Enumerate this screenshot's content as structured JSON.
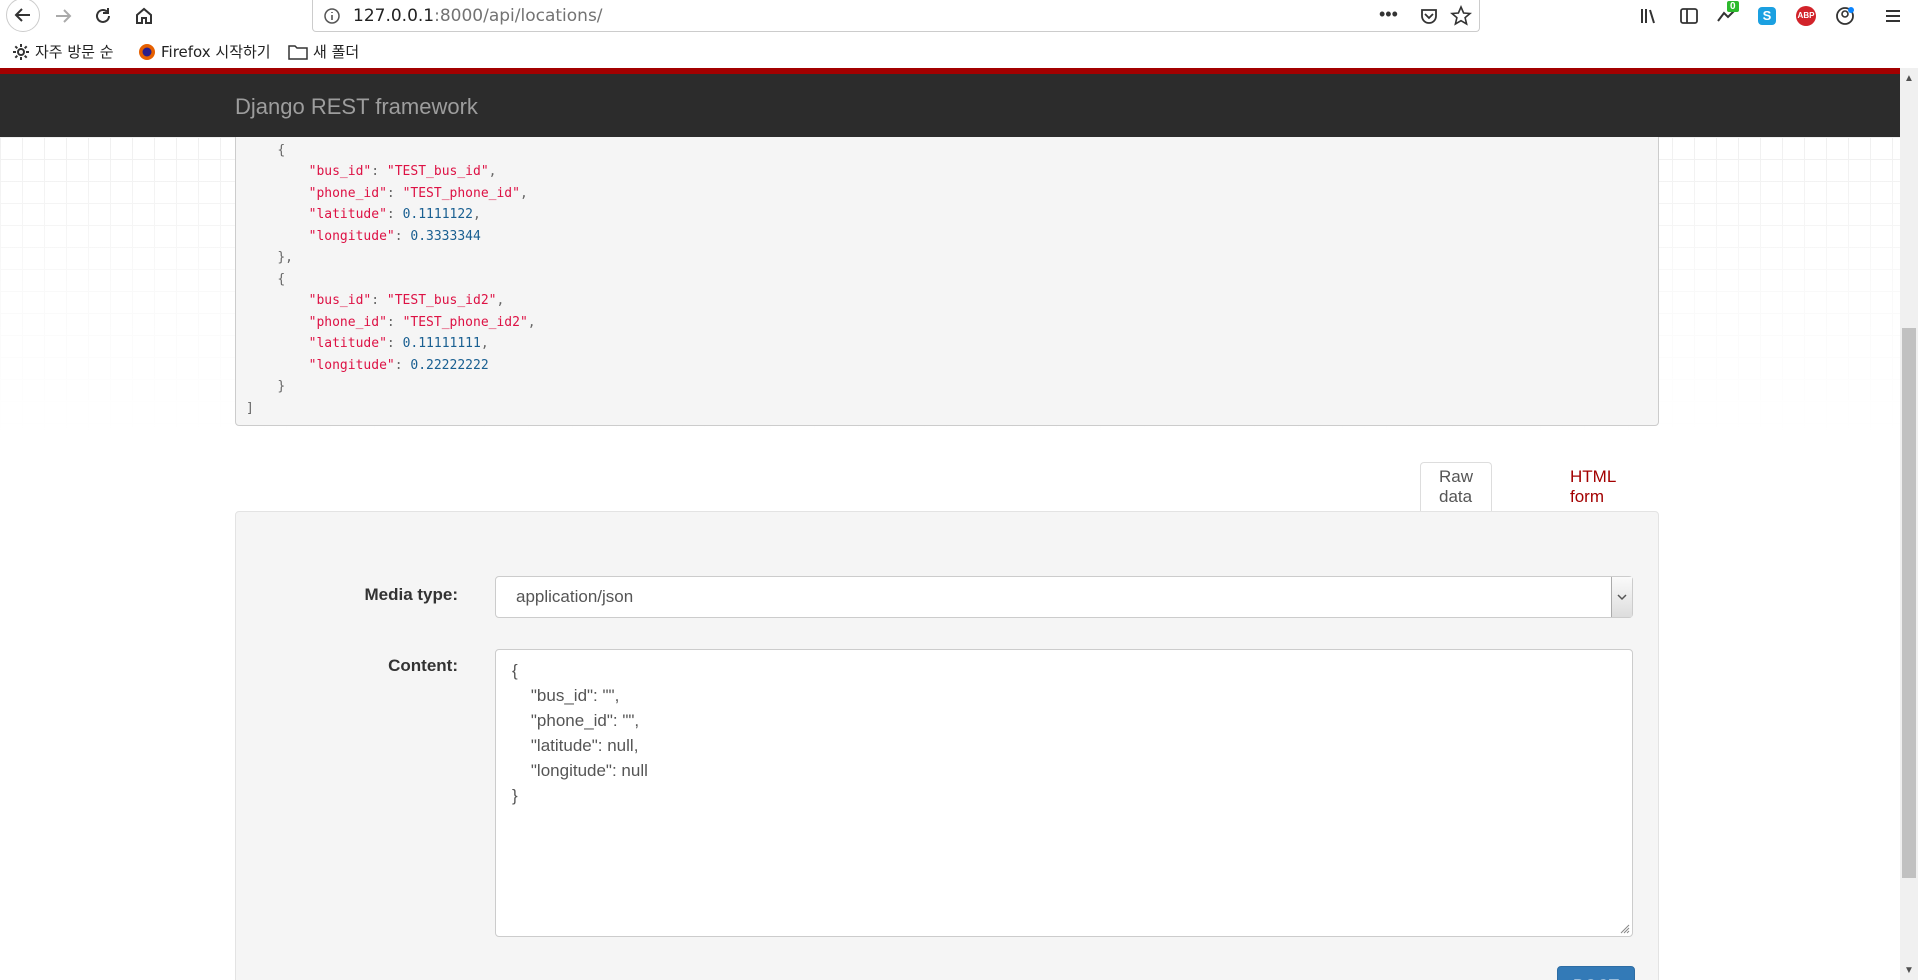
{
  "browser": {
    "url_host": "127.0.0.1",
    "url_path": ":8000/api/locations/",
    "badge_count": "0",
    "abp_label": "ABP"
  },
  "bookmarks": [
    {
      "label": "자주 방문 순"
    },
    {
      "label": "Firefox 시작하기"
    },
    {
      "label": "새 폴더"
    }
  ],
  "navbar": {
    "brand": "Django REST framework"
  },
  "response": {
    "items": [
      {
        "bus_id": "\"TEST_bus_id\"",
        "phone_id": "\"TEST_phone_id\"",
        "latitude": "0.1111122",
        "longitude": "0.3333344"
      },
      {
        "bus_id": "\"TEST_bus_id2\"",
        "phone_id": "\"TEST_phone_id2\"",
        "latitude": "0.11111111",
        "longitude": "0.22222222"
      }
    ],
    "keys": {
      "bus_id": "\"bus_id\"",
      "phone_id": "\"phone_id\"",
      "latitude": "\"latitude\"",
      "longitude": "\"longitude\""
    }
  },
  "form": {
    "tabs": {
      "raw": "Raw data",
      "html": "HTML form"
    },
    "media_type_label": "Media type:",
    "media_type_value": "application/json",
    "content_label": "Content:",
    "content_value": "{\n    \"bus_id\": \"\",\n    \"phone_id\": \"\",\n    \"latitude\": null,\n    \"longitude\": null\n}",
    "post_label": "POST"
  },
  "colors": {
    "accent_red": "#a30000",
    "navbar": "#2c2c2c",
    "post_button": "#337ab7"
  }
}
